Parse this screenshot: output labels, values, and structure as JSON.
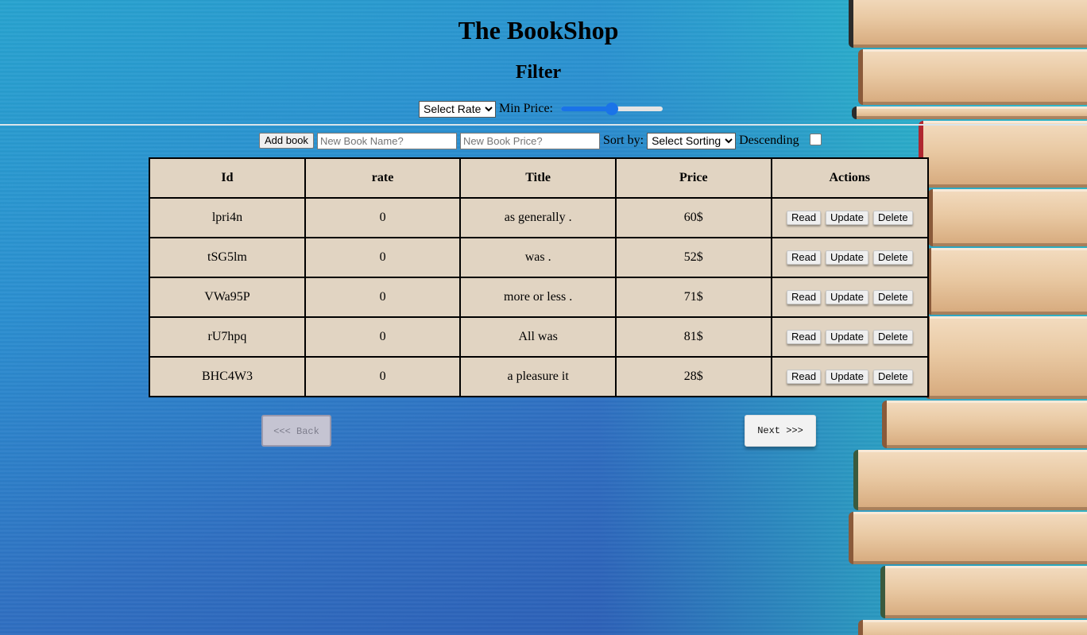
{
  "header": {
    "title": "The BookShop",
    "filter_heading": "Filter"
  },
  "filter": {
    "rate_select": "Select Rate",
    "min_price_label": "Min Price:",
    "min_price_slider_fraction": 0.5
  },
  "toolbar": {
    "add_button": "Add book",
    "name_placeholder": "New Book Name?",
    "price_placeholder": "New Book Price?",
    "sort_label": "Sort by:",
    "sort_select": "Select Sorting",
    "descending_label": "Descending",
    "descending_checked": false
  },
  "table": {
    "headers": [
      "Id",
      "rate",
      "Title",
      "Price",
      "Actions"
    ],
    "rows": [
      {
        "id": "lpri4n",
        "rate": "0",
        "title": "as generally .",
        "price": "60$"
      },
      {
        "id": "tSG5lm",
        "rate": "0",
        "title": "was .",
        "price": "52$"
      },
      {
        "id": "VWa95P",
        "rate": "0",
        "title": "more or less .",
        "price": "71$"
      },
      {
        "id": "rU7hpq",
        "rate": "0",
        "title": "All was",
        "price": "81$"
      },
      {
        "id": "BHC4W3",
        "rate": "0",
        "title": "a pleasure it",
        "price": "28$"
      }
    ],
    "actions": {
      "read": "Read",
      "update": "Update",
      "delete": "Delete"
    }
  },
  "pagination": {
    "back": "<<< Back",
    "next": "Next >>>"
  },
  "colors": {
    "table_background": "#e1d4c2",
    "slider_accent": "#1a73e8"
  }
}
